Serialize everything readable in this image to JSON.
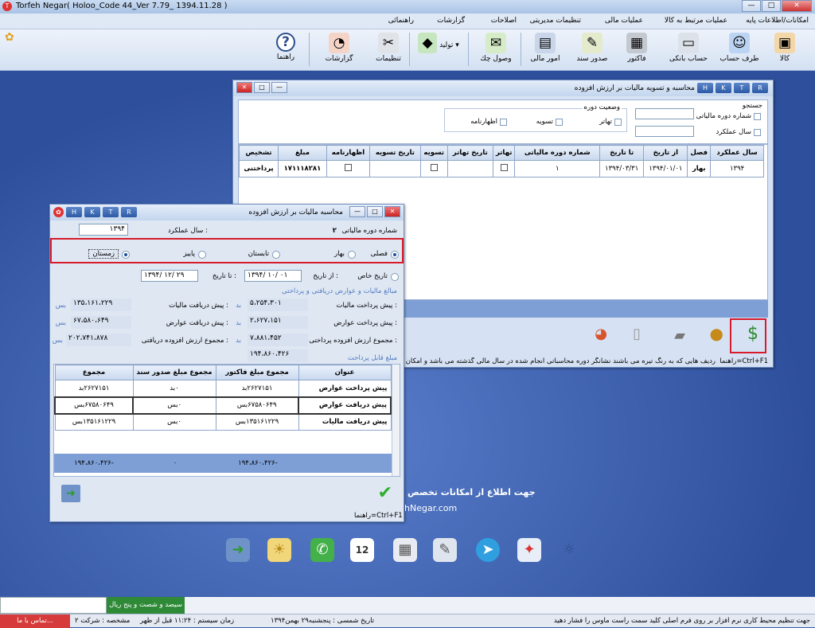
{
  "app": {
    "title": "Torfeh Negar( Holoo_Code 44_Ver 7.79_                 1394.11.28 )",
    "win_min": "—",
    "win_max": "□",
    "win_close": "✕"
  },
  "menu": [
    "امکانات/اطلاعات پایه",
    "عملیات مرتبط به کالا",
    "عملیات مالی",
    "تنظیمات مدیریتی",
    "اصلاحات",
    "گزارشات",
    "راهنمائی"
  ],
  "toolbar": {
    "items": [
      {
        "label": "کالا",
        "icon": "box-icon",
        "color": "#e89a2c"
      },
      {
        "label": "طرف حساب",
        "icon": "person-icon",
        "color": "#3c7fd8"
      },
      {
        "label": "حساب بانکی",
        "icon": "bank-card-icon",
        "color": "#9aa3b0"
      },
      {
        "label": "فاکتور",
        "icon": "calculator-icon",
        "color": "#5a6270"
      },
      {
        "label": "صدور سند",
        "icon": "document-pen-icon",
        "color": "#7a8b4a"
      },
      {
        "label": "امور مالی",
        "icon": "cash-register-icon",
        "color": "#4f6f9f"
      },
      {
        "label": "وصول چك",
        "icon": "cheque-icon",
        "color": "#5e9d3a"
      },
      {
        "label": "تولید",
        "icon": "cube-icon",
        "color": "#3f9a3a"
      },
      {
        "label": "تنظیمات",
        "icon": "tools-icon",
        "color": "#8a8f99"
      },
      {
        "label": "گزارشات",
        "icon": "chart-icon",
        "color": "#d8542c"
      },
      {
        "label": "راهنما",
        "icon": "help-icon",
        "color": "#2d4e8c"
      }
    ]
  },
  "back_window": {
    "title": "محاسبه و تسویه مالیات بر ارزش افزوده",
    "hk": [
      "H",
      "K",
      "T",
      "R"
    ],
    "search_label": "جستجو",
    "period_no_label": "شماره دوره مالیاتی",
    "year_label": "سال عملکرد",
    "state_label": "وضعیت دوره",
    "state_opts": [
      "تهاتر",
      "تسویه",
      "اظهارنامه"
    ],
    "columns": [
      "سال عملکرد",
      "فصل",
      "از تاریخ",
      "تا تاریخ",
      "شماره دوره مالیاتی",
      "تهاتر",
      "تاریخ تهاتر",
      "تسویه",
      "تاریخ تسویه",
      "اظهارنامه",
      "مبلغ",
      "تشخیص"
    ],
    "row": {
      "year": "۱۳۹۴",
      "season": "بهار",
      "from": "۱۳۹۴/۰۱/۰۱",
      "to": "۱۳۹۴/۰۳/۳۱",
      "period": "۱",
      "amount": "۱۷۱۱۱۸۲۸۱",
      "diag": "پرداختنی"
    },
    "footer_hint": "ردیف هایی که به رنگ تیره می باشند نشانگر دوره محاسباتی انجام شده در سال مالی گذشته می باشد و امکان",
    "help_shortcut": "راهنما=Ctrl+F1"
  },
  "front_window": {
    "title": "محاسبه مالیات بر ارزش افزوده",
    "hk": [
      "H",
      "K",
      "T",
      "R"
    ],
    "period_label": "شماره دوره مالیاتی",
    "period_value": "۲",
    "year_label": "سال عملکرد :",
    "year_value": "۱۳۹۴",
    "seasonal_label": "فصلی",
    "seasons": [
      "بهار",
      "تابستان",
      "پاییز",
      "زمستان"
    ],
    "custom_date_label": "تاریخ خاص",
    "from_label": "از تاریخ :",
    "from_value": "۱۳۹۴/ ۱۰/ ۰۱",
    "to_label": "تا تاریخ :",
    "to_value": "۱۳۹۴/ ۱۲/ ۲۹",
    "section_title": "مبالغ مالیات و عوارض دریافتی و پرداختی",
    "prepay_tax_label": "پیش پرداخت مالیات :",
    "prepay_tax": "۵،۲۵۴،۳۰۱",
    "prepay_fee_label": "پیش پرداخت عوارض :",
    "prepay_fee": "۲،۶۲۷،۱۵۱",
    "sum_paid_label": "مجموع ارزش افزوده پرداختی :",
    "sum_paid": "۷،۸۸۱،۴۵۲",
    "recv_tax_label": "پیش دریافت مالیات :",
    "recv_tax": "۱۳۵،۱۶۱،۲۲۹",
    "recv_fee_label": "پیش دریافت عوارض :",
    "recv_fee": "۶۷،۵۸۰،۶۴۹",
    "sum_recv_label": "مجموع ارزش افزوده دریافتی :",
    "sum_recv": "۲۰۲،۷۴۱،۸۷۸",
    "payable_label": "مبلغ قابل پرداخت",
    "payable": "۱۹۴،۸۶۰،۴۲۶",
    "unit_bed": "بد",
    "unit_bes": "بس",
    "grid_cols": [
      "عنوان",
      "مجموع مبلغ فاکتور",
      "مجموع مبلغ صدور سند",
      "مجموع"
    ],
    "grid_rows": [
      [
        "پیش پرداخت عوارض",
        "۲۶۲۷۱۵۱بد",
        "۰بد",
        "۲۶۲۷۱۵۱بد"
      ],
      [
        "پیش دریافت عوارض",
        "۶۷۵۸۰۶۴۹بس",
        "۰بس",
        "۶۷۵۸۰۶۴۹بس"
      ],
      [
        "پیش دریافت مالیات",
        "۱۳۵۱۶۱۲۲۹بس",
        "۰بس",
        "۱۳۵۱۶۱۲۲۹بس"
      ]
    ],
    "grid_footer": [
      "-۱۹۴،۸۶۰،۴۲۶",
      "۰",
      "-۱۹۴،۸۶۰،۴۲۶"
    ],
    "help_shortcut": "راهنما=Ctrl+F1"
  },
  "desktop_text": {
    "line1": "جهت اطلاع از امکانات تخصص",
    "line2": "hNegar.com"
  },
  "taskbar": {
    "green_label": "سیصد و شصت و پنج ریال"
  },
  "status": {
    "hint": "جهت تنظیم محیط کاری نرم افزار بر روی فرم اصلی کلید سمت راست ماوس را فشار دهید",
    "date": "تاریخ شمسی : پنجشنبه۲۹ بهمن۱۳۹۴",
    "time": "زمان سیستم : ۱۱:۲۴ قبل از ظهر",
    "company": "مشخصه : شرکت ۲",
    "contact": "تماس با ما..."
  }
}
